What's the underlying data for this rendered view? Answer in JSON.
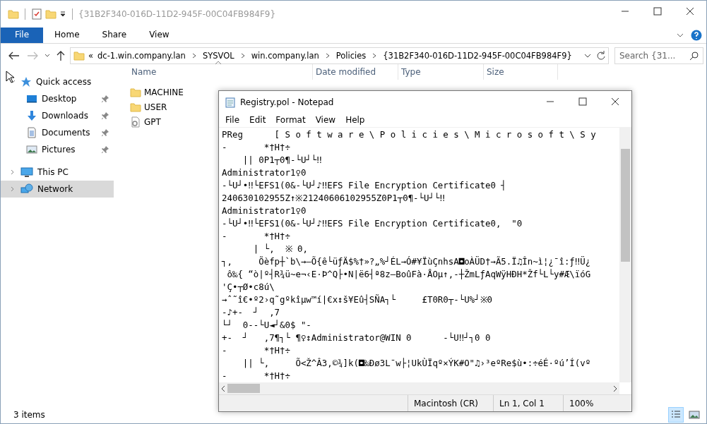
{
  "explorer": {
    "title": "{31B2F340-016D-11D2-945F-00C04FB984F9}",
    "ribbon_tabs": [
      {
        "label": "File",
        "selected": true
      },
      {
        "label": "Home",
        "selected": false
      },
      {
        "label": "Share",
        "selected": false
      },
      {
        "label": "View",
        "selected": false
      }
    ],
    "breadcrumb": [
      "«",
      "dc-1.win.company.lan",
      "SYSVOL",
      "win.company.lan",
      "Policies",
      "{31B2F340-016D-11D2-945F-00C04FB984F9}"
    ],
    "search": {
      "placeholder": "Search {31..."
    },
    "columns": [
      "Name",
      "Date modified",
      "Type",
      "Size"
    ],
    "nav": [
      {
        "label": "Quick access",
        "kind": "star",
        "pinned": false,
        "selected": false,
        "children": [
          {
            "label": "Desktop",
            "kind": "desktop",
            "pinned": true,
            "selected": false
          },
          {
            "label": "Downloads",
            "kind": "download",
            "pinned": true,
            "selected": false
          },
          {
            "label": "Documents",
            "kind": "document",
            "pinned": true,
            "selected": false
          },
          {
            "label": "Pictures",
            "kind": "picture",
            "pinned": true,
            "selected": false
          }
        ]
      },
      {
        "label": "This PC",
        "kind": "pc",
        "pinned": false,
        "selected": false
      },
      {
        "label": "Network",
        "kind": "network",
        "pinned": false,
        "selected": true
      }
    ],
    "files": [
      {
        "name": "MACHINE",
        "kind": "folder"
      },
      {
        "name": "USER",
        "kind": "folder"
      },
      {
        "name": "GPT",
        "kind": "settings"
      }
    ],
    "status": "3 items",
    "views": [
      {
        "kind": "details",
        "selected": true
      },
      {
        "kind": "thumbnails",
        "selected": false
      }
    ]
  },
  "notepad": {
    "title": "Registry.pol - Notepad",
    "menu": [
      "File",
      "Edit",
      "Format",
      "View",
      "Help"
    ],
    "lines": [
      "PReg      [ S o f t w a r e \\ P o l i c i e s \\ M i c r o s o f t \\ S y",
      "-       *†H†÷",
      "    || 0P1┬0¶-└U┘└‼",
      "Administrator1♀0",
      "-└U┘•‼└EFS1(0&-└U┘♪‼EFS File Encryption Certificate0 ┤",
      "240630102955Z↑※21240606102955Z0P1┬0¶-└U┘└‼",
      "Administrator1♀0",
      "-└U┘•‼└EFS1(0&-└U┘♪‼EFS File Encryption Certificate0,  \"0",
      "-       *†H†÷",
      "      | └,  ※ 0,",
      "┐,     Õèfp┼`b\\→—Õ{ê└üƒÄ$%†»?„%┘ÉL→Ó#¥ÏùÇnhsA◘oÀÜD†→Ã5.Ï♫În~ì¦¿¯î:ƒ‼Ü¿",
      " ô‰{ “ò|º┤R¾ü~e¬‹E·Þ^Q├•N|ë6┤ª8z—BoûFà·ÅOµ↑‚-┼ŽmLƒAqWÿHÐH*Žf└L└y#Æ\\ïóG",
      "'Ç•┬Ø•c8ú\\",
      "→ˆ˜î€•º2›q˜gºkîµw™í|€x↕š¥Eû┤SÑA┐└     £T0R0┬-└U%┘※0",
      "-♪+-  ┘  ,7",
      "└┘  0--└U◄┘&0$ \"-",
      "+-  ┘   ,7¶┐└ ¶♀↕Administrator@WIN 0      -└U‼┘┐0 0",
      "-       *†H†÷",
      "    || └,     Õ<Ž^Â3,©¾]k(◘‰Ðø3L¯w├¦UkÙÏqº×ÝK#O\"♫›³eºRe$ù•:÷éÉ·ºú’Í(vº",
      "-       *†H†÷"
    ],
    "status": [
      "Macintosh (CR)",
      "Ln 1, Col 1",
      "100%"
    ]
  }
}
